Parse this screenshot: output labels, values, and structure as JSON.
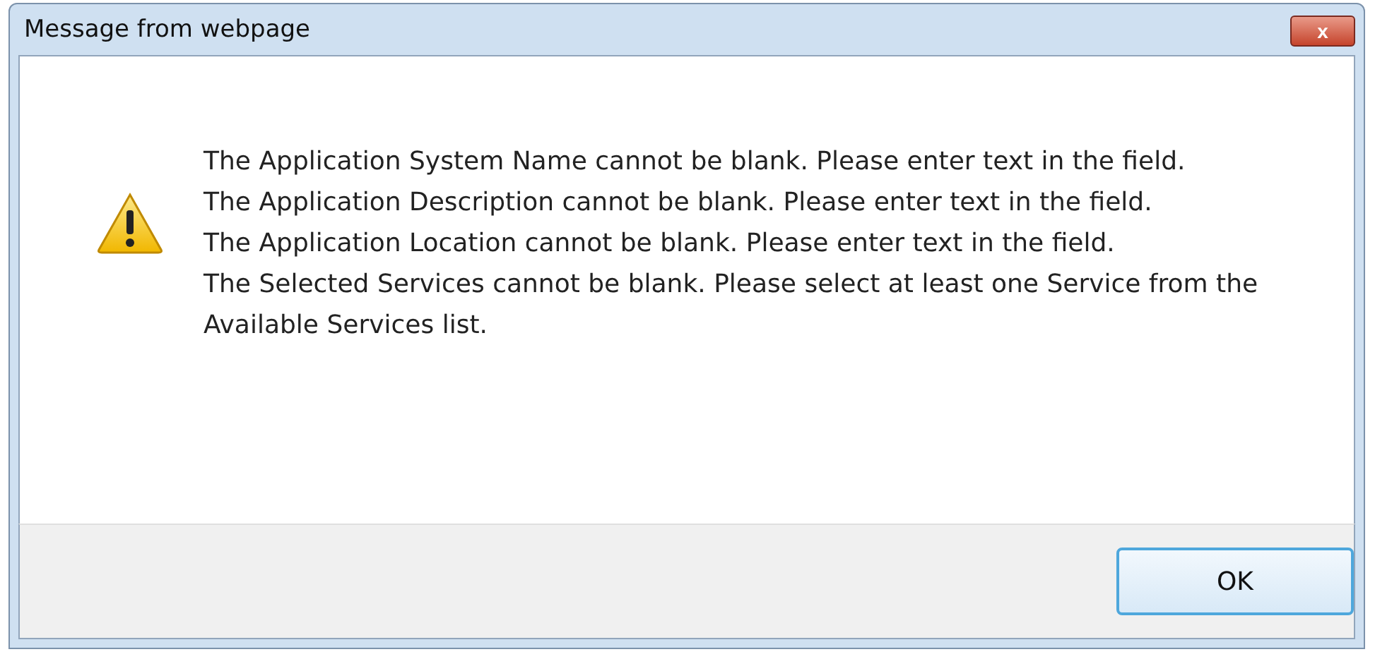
{
  "window": {
    "title": "Message from webpage",
    "close": "x"
  },
  "messages": [
    "The Application System Name cannot be blank.  Please enter text in the field.",
    "The Application Description cannot be blank.  Please enter text in the field.",
    "The Application Location cannot be blank.  Please enter text in the field.",
    "The Selected Services cannot be blank.  Please select at least one Service from the Available Services list."
  ],
  "buttons": [
    "OK"
  ]
}
